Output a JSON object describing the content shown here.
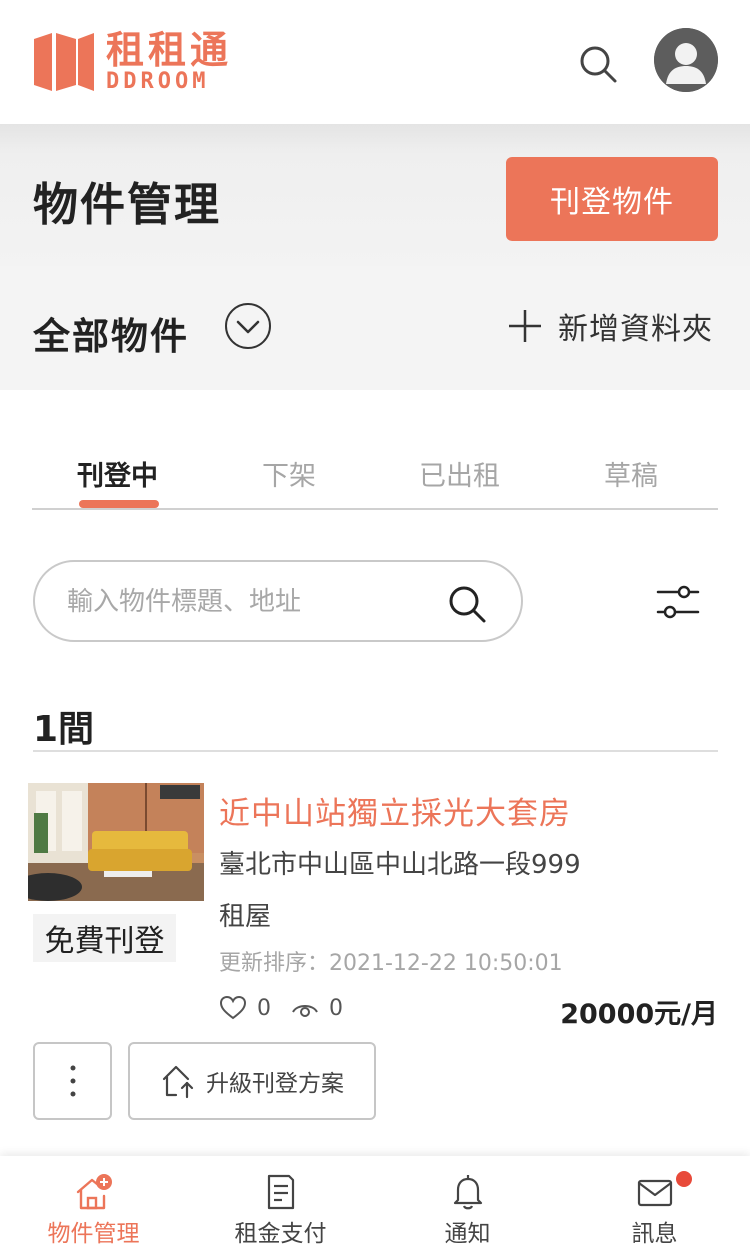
{
  "header": {
    "logo_cn": "租租通",
    "logo_en": "DDROOM",
    "search_icon": "search-icon",
    "avatar_icon": "user-avatar-icon"
  },
  "title_band": {
    "title": "物件管理",
    "publish_button": "刊登物件"
  },
  "folder_band": {
    "folder_name": "全部物件",
    "new_folder": "新增資料夾"
  },
  "tabs": [
    {
      "label": "刊登中",
      "active": true
    },
    {
      "label": "下架",
      "active": false
    },
    {
      "label": "已出租",
      "active": false
    },
    {
      "label": "草稿",
      "active": false
    }
  ],
  "search": {
    "placeholder": "輸入物件標題、地址",
    "value": ""
  },
  "count_label": "1間",
  "listing": {
    "badge": "免費刊登",
    "title": "近中山站獨立採光大套房",
    "address": "臺北市中山區中山北路一段999",
    "type": "租屋",
    "updated": "更新排序：2021-12-22 10:50:01",
    "likes": "0",
    "views": "0",
    "price": "20000元/月",
    "more_button": "⋮",
    "upgrade_button": "升級刊登方案"
  },
  "bottom_nav": [
    {
      "label": "物件管理",
      "icon": "home-plus-icon",
      "active": true
    },
    {
      "label": "租金支付",
      "icon": "document-icon",
      "active": false
    },
    {
      "label": "通知",
      "icon": "bell-icon",
      "active": false
    },
    {
      "label": "訊息",
      "icon": "mail-icon",
      "active": false,
      "unread_dot": true
    }
  ],
  "colors": {
    "accent": "#ec7559",
    "tab_inactive": "#a6a6a6",
    "unread_dot": "#e84a3a"
  }
}
